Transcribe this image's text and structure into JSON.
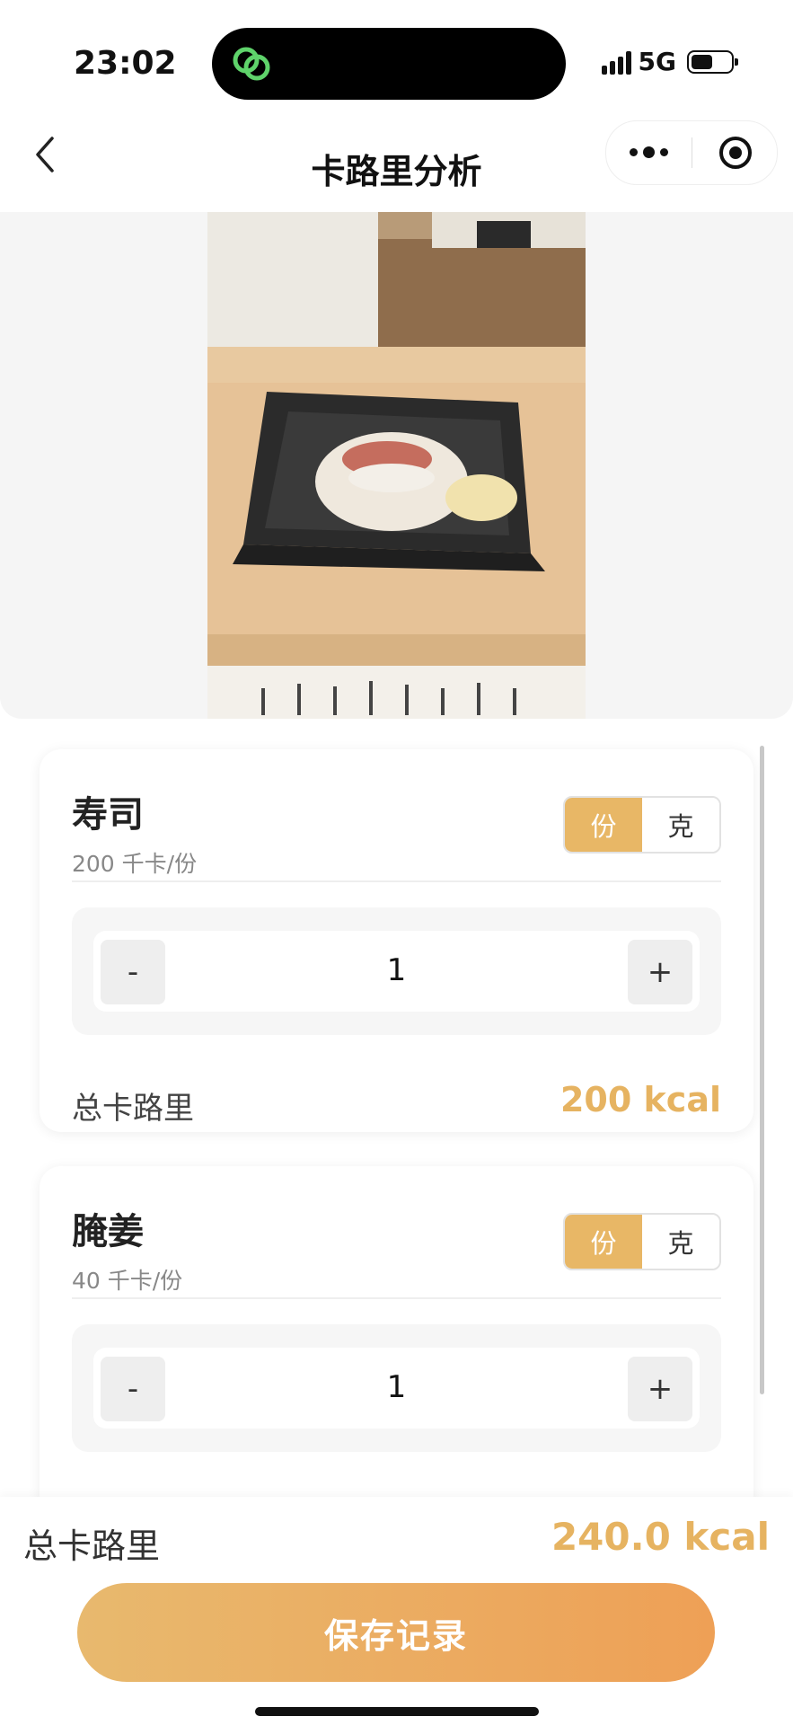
{
  "status_bar": {
    "time": "23:02",
    "network": "5G",
    "battery_level": 0.55
  },
  "nav": {
    "title": "卡路里分析"
  },
  "items": [
    {
      "name": "寿司",
      "unit_calories": "200 千卡/份",
      "units": [
        "份",
        "克"
      ],
      "selected_unit": "份",
      "quantity": "1",
      "minus_label": "-",
      "plus_label": "+",
      "total_label": "总卡路里",
      "total_value": "200 kcal"
    },
    {
      "name": "腌姜",
      "unit_calories": "40 千卡/份",
      "units": [
        "份",
        "克"
      ],
      "selected_unit": "份",
      "quantity": "1",
      "minus_label": "-",
      "plus_label": "+"
    }
  ],
  "footer": {
    "total_label": "总卡路里",
    "total_value": "240.0 kcal",
    "save_label": "保存记录"
  },
  "colors": {
    "accent": "#e6b361",
    "button_start": "#e8b96e",
    "button_end": "#eea056"
  },
  "icons": [
    "wechat-capsule-icon",
    "signal-icon",
    "battery-icon",
    "back-icon",
    "more-icon",
    "close-target-icon"
  ]
}
